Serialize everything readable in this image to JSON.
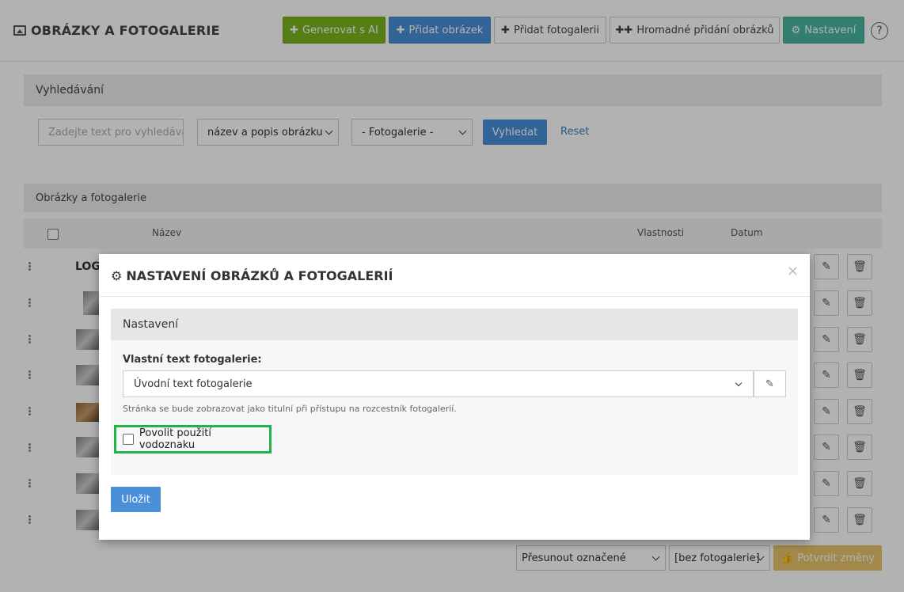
{
  "header": {
    "title": "OBRÁZKY A FOTOGALERIE",
    "buttons": {
      "ai": "Generovat s AI",
      "add_image": "Přidat obrázek",
      "add_gallery": "Přidat fotogalerii",
      "bulk_add": "Hromadné přidání obrázků",
      "settings": "Nastavení"
    },
    "help": "?"
  },
  "search": {
    "title": "Vyhledávání",
    "placeholder": "Zadejte text pro vyhledává",
    "field_select": "název a popis obrázku",
    "gallery_select": "- Fotogalerie -",
    "search_button": "Vyhledat",
    "reset_link": "Reset"
  },
  "list": {
    "title": "Obrázky a fotogalerie",
    "columns": {
      "name": "Název",
      "properties": "Vlastnosti",
      "date": "Datum"
    },
    "first_row_label": "LOG"
  },
  "bulk": {
    "move_select": "Přesunout označené",
    "gallery_select": "[bez fotogalerie]",
    "confirm_button": "Potvrdit změny"
  },
  "modal": {
    "title": "NASTAVENÍ OBRÁZKŮ A FOTOGALERIÍ",
    "close": "×",
    "section_title": "Nastavení",
    "field_label": "Vlastní text fotogalerie:",
    "field_value": "Úvodní text fotogalerie",
    "help_text": "Stránka se bude zobrazovat jako titulní při přístupu na rozcestník fotogalerií.",
    "watermark_label": "Povolit použití vodoznaku",
    "save_button": "Uložit"
  },
  "colors": {
    "green": "#7ab51d",
    "blue": "#4a90d9",
    "teal": "#48b5a0",
    "highlight": "#22b24c",
    "confirm": "#e8c36a"
  }
}
